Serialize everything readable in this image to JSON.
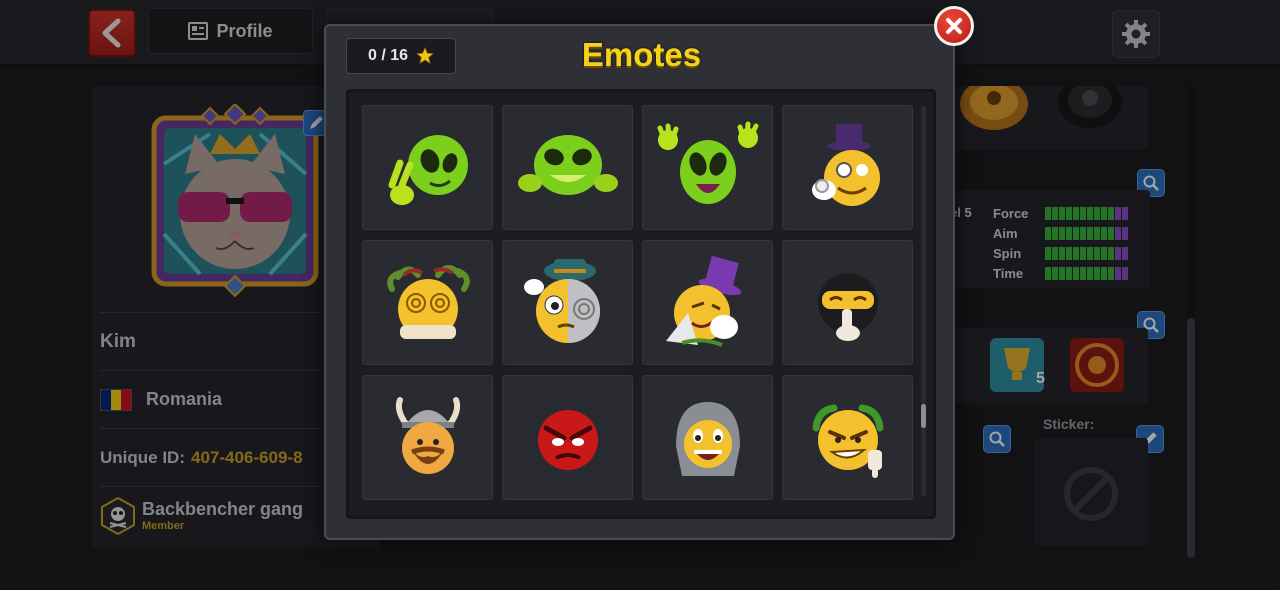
{
  "topbar": {
    "back_icon": "chevron-left-icon",
    "profile_tab_label": "Profile",
    "profile_tab_icon": "profile-card-icon",
    "settings_icon": "gear-icon"
  },
  "profile": {
    "name": "Kim",
    "country": "Romania",
    "country_flag_colors": [
      "#002b7f",
      "#fcd116",
      "#ce1126"
    ],
    "unique_id_label": "Unique ID:",
    "unique_id_value": "407-406-609-8",
    "club_name": "Backbencher gang",
    "club_role": "Member"
  },
  "stats": {
    "level_partial": "el 5",
    "items": [
      {
        "label": "Force"
      },
      {
        "label": "Aim"
      },
      {
        "label": "Spin"
      },
      {
        "label": "Time"
      }
    ]
  },
  "side": {
    "sticker_label": "Sticker:",
    "achievement_count": "5"
  },
  "modal": {
    "title": "Emotes",
    "counter": "0 / 16",
    "counter_icon": "star-icon",
    "close_icon": "close-icon",
    "emotes": [
      {
        "name": "alien-peace-emote"
      },
      {
        "name": "alien-grin-emote"
      },
      {
        "name": "alien-waving-emote"
      },
      {
        "name": "gentleman-monocle-emote"
      },
      {
        "name": "dizzy-medusa-emote"
      },
      {
        "name": "hypnotized-emote"
      },
      {
        "name": "magician-emote"
      },
      {
        "name": "ninja-shush-emote"
      },
      {
        "name": "viking-emote"
      },
      {
        "name": "angry-red-emote"
      },
      {
        "name": "knight-emote"
      },
      {
        "name": "emperor-thumbs-down-emote"
      }
    ]
  },
  "colors": {
    "title_yellow": "#f5d21c",
    "id_gold": "#c9a227",
    "close_red": "#d8281c",
    "stat_green": "#38b33a",
    "stat_purple": "#8a4fc7"
  }
}
